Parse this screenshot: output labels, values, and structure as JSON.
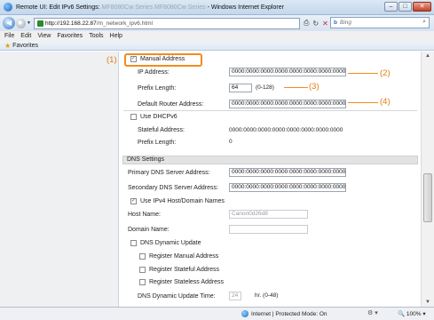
{
  "window": {
    "title_prefix": "Remote UI: Edit IPv6 Settings:",
    "title_blurred": "MF8080Cw Series MF8080Cw Series",
    "title_suffix": "- Windows Internet Explorer",
    "buttons": {
      "minimize": "–",
      "maximize": "□",
      "close": "✕"
    }
  },
  "address_bar": {
    "url_host": "http://192.168.22.87",
    "url_path": "/m_network_ipv6.html",
    "search_placeholder": "Bing",
    "search_brand": "b"
  },
  "menu": [
    "File",
    "Edit",
    "View",
    "Favorites",
    "Tools",
    "Help"
  ],
  "favorites_label": "Favorites",
  "form": {
    "manual_address": {
      "label": "Manual Address",
      "checked": true
    },
    "ip_address": {
      "label": "IP Address:",
      "value": "0000:0000:0000:0000:0000:0000:0000:0000"
    },
    "prefix_length": {
      "label": "Prefix Length:",
      "value": "64",
      "hint": "(0-128)"
    },
    "default_router": {
      "label": "Default Router Address:",
      "value": "0000:0000:0000:0000:0000:0000:0000:0000"
    },
    "use_dhcpv6": {
      "label": "Use DHCPv6",
      "checked": false
    },
    "stateful_address": {
      "label": "Stateful Address:",
      "value": "0000:0000:0000:0000:0000:0000:0000:0000"
    },
    "stateful_prefix": {
      "label": "Prefix Length:",
      "value": "0"
    },
    "dns_section_title": "DNS Settings",
    "primary_dns": {
      "label": "Primary DNS Server Address:",
      "value": "0000:0000:0000:0000:0000:0000:0000:0000"
    },
    "secondary_dns": {
      "label": "Secondary DNS Server Address:",
      "value": "0000:0000:0000:0000:0000:0000:0000:0000"
    },
    "use_ipv4_host": {
      "label": "Use IPv4 Host/Domain Names",
      "checked": true
    },
    "host_name": {
      "label": "Host Name:",
      "value": "Canon0d26d8"
    },
    "domain_name": {
      "label": "Domain Name:",
      "value": ""
    },
    "dns_dynamic_update": {
      "label": "DNS Dynamic Update",
      "checked": false
    },
    "register_manual": {
      "label": "Register Manual Address",
      "checked": false
    },
    "register_stateful": {
      "label": "Register Stateful Address",
      "checked": false
    },
    "register_stateless": {
      "label": "Register Stateless Address",
      "checked": false
    },
    "update_time": {
      "label": "DNS Dynamic Update Time:",
      "value": "24",
      "unit": "hr. (0-48)"
    }
  },
  "callouts": [
    "(1)",
    "(2)",
    "(3)",
    "(4)"
  ],
  "status_bar": {
    "zone": "Internet | Protected Mode: On",
    "zoom": "100%"
  },
  "colors": {
    "callout": "#f28c1e",
    "title_gradient": "#c3d6ec"
  }
}
